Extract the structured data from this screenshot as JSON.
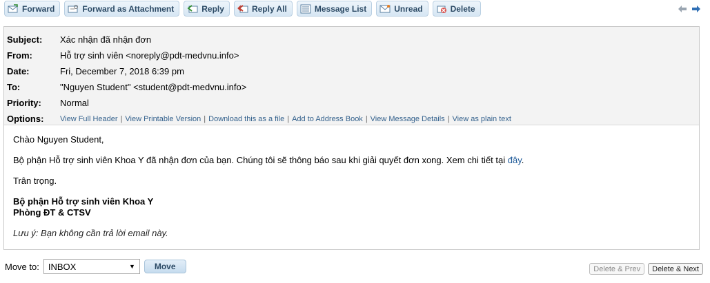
{
  "toolbar": {
    "buttons": [
      {
        "label": "Forward",
        "icon": "forward-icon"
      },
      {
        "label": "Forward as Attachment",
        "icon": "forward-attachment-icon"
      },
      {
        "label": "Reply",
        "icon": "reply-icon"
      },
      {
        "label": "Reply All",
        "icon": "reply-all-icon"
      },
      {
        "label": "Message List",
        "icon": "message-list-icon"
      },
      {
        "label": "Unread",
        "icon": "unread-icon"
      },
      {
        "label": "Delete",
        "icon": "delete-icon"
      }
    ],
    "nav": {
      "prev_icon": "arrow-left-icon",
      "next_icon": "arrow-right-icon"
    }
  },
  "header": {
    "subject_label": "Subject:",
    "subject": "Xác nhận đã nhận đơn",
    "from_label": "From:",
    "from": "Hỗ trợ sinh viên <noreply@pdt-medvnu.info>",
    "date_label": "Date:",
    "date": "Fri, December 7, 2018 6:39 pm",
    "to_label": "To:",
    "to": "\"Nguyen Student\" <student@pdt-medvnu.info>",
    "priority_label": "Priority:",
    "priority": "Normal",
    "options_label": "Options:",
    "options": [
      "View Full Header",
      "View Printable Version",
      "Download this as a file",
      "Add to Address Book",
      "View Message Details",
      "View as plain text"
    ]
  },
  "body": {
    "greeting": "Chào Nguyen Student,",
    "main_text": "Bộ phận Hỗ trợ sinh viên Khoa Y đã nhận đơn của bạn. Chúng tôi sẽ thông báo sau khi giải quyết đơn xong. Xem chi tiết tại ",
    "link_text": "đây",
    "main_end": ".",
    "regards": "Trân trọng.",
    "sig_line1": "Bộ phận Hỗ trợ sinh viên Khoa Y",
    "sig_line2": "Phòng ĐT & CTSV",
    "note": "Lưu ý: Bạn không cần trả lời email này."
  },
  "footer": {
    "move_to_label": "Move to:",
    "folder": "INBOX",
    "move_button": "Move",
    "delete_prev": "Delete & Prev",
    "delete_next": "Delete & Next"
  }
}
